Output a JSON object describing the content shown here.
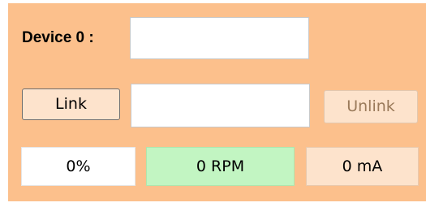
{
  "device": {
    "label": "Device 0 :",
    "value": ""
  },
  "link": {
    "link_button_label": "Link",
    "value": "",
    "unlink_button_label": "Unlink"
  },
  "status": {
    "percent": "0%",
    "rpm": "0 RPM",
    "current": "0 mA"
  },
  "colors": {
    "panel_background": "#fcc08c",
    "button_background": "#fde3cc",
    "rpm_background": "#c2f5c2",
    "disabled_text": "#9a7a5a"
  }
}
